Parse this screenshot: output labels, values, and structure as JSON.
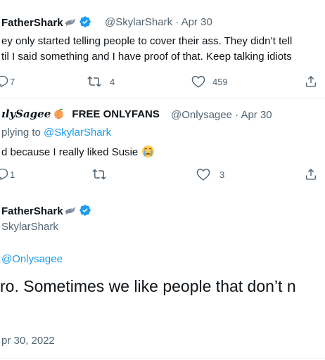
{
  "tweet1": {
    "display_name": "FatherShark",
    "handle_time": "@SkylarShark · Apr 30",
    "line1": "ey only started telling people to cover their ass. They didn’t tell",
    "line2": "til I said something and I have proof of that. Keep talking idiots",
    "reply_count": "7",
    "retweet_count": "4",
    "like_count": "459"
  },
  "tweet2": {
    "display_name_script": "ılySagee",
    "display_name_plain": "FREE ONLYFANS",
    "handle_time": "@Onlysagee · Apr 30",
    "replying_prefix": "plying to ",
    "replying_handle": "@SkylarShark",
    "text": "d because I really liked Susie",
    "reply_count": "1",
    "like_count": "3"
  },
  "main_tweet": {
    "display_name": "FatherShark",
    "handle": "SkylarShark",
    "replying_handle": "@Onlysagee",
    "text": "ro. Sometimes we like people that don’t n",
    "date": "pr 30, 2022"
  },
  "colors": {
    "accent": "#1d9bf0",
    "secondary_text": "#536471",
    "primary_text": "#0f1419"
  },
  "icons": [
    "shark-emoji",
    "verified-badge",
    "peach-emoji",
    "crying-emoji",
    "reply-icon",
    "retweet-icon",
    "like-icon",
    "share-icon"
  ]
}
